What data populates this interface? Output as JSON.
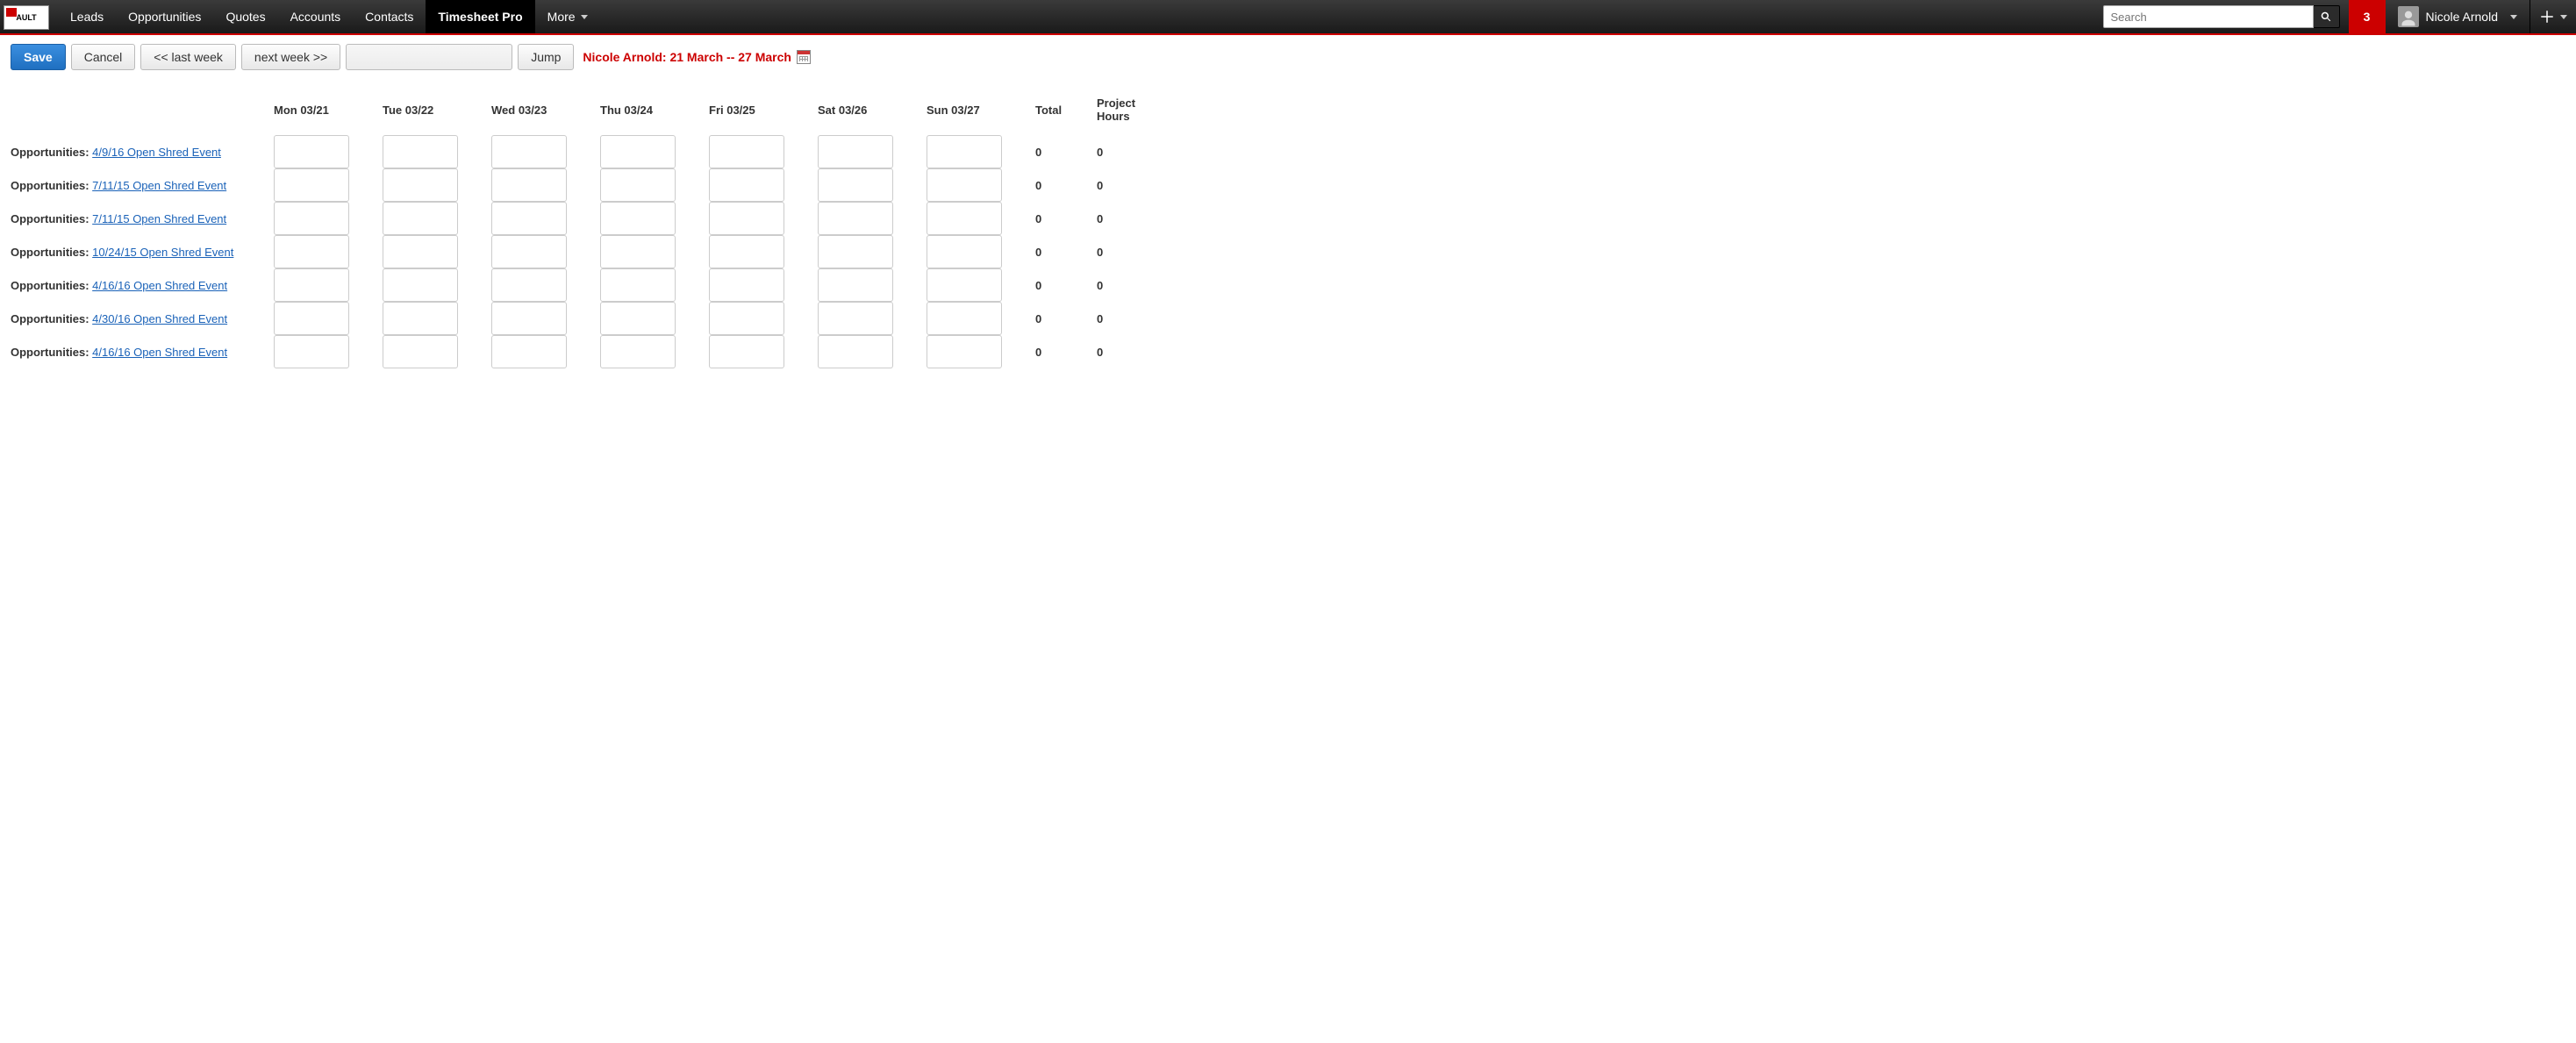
{
  "brand": {
    "logo_text": "AULT"
  },
  "nav": {
    "items": [
      "Leads",
      "Opportunities",
      "Quotes",
      "Accounts",
      "Contacts",
      "Timesheet Pro",
      "More"
    ],
    "active_index": 5
  },
  "search": {
    "placeholder": "Search"
  },
  "notifications": {
    "count": "3"
  },
  "user": {
    "name": "Nicole Arnold"
  },
  "toolbar": {
    "save": "Save",
    "cancel": "Cancel",
    "prev_week": "<< last week",
    "next_week": "next week >>",
    "jump": "Jump",
    "date_value": "",
    "range_label": "Nicole Arnold: 21 March -- 27 March"
  },
  "columns": {
    "days": [
      "Mon 03/21",
      "Tue 03/22",
      "Wed 03/23",
      "Thu 03/24",
      "Fri 03/25",
      "Sat 03/26",
      "Sun 03/27"
    ],
    "total": "Total",
    "project_hours": "Project Hours"
  },
  "rows": [
    {
      "prefix": "Opportunities:",
      "link": "4/9/16 Open Shred Event",
      "hours": [
        "",
        "",
        "",
        "",
        "",
        "",
        ""
      ],
      "total": "0",
      "project_hours": "0"
    },
    {
      "prefix": "Opportunities:",
      "link": "7/11/15 Open Shred Event",
      "hours": [
        "",
        "",
        "",
        "",
        "",
        "",
        ""
      ],
      "total": "0",
      "project_hours": "0"
    },
    {
      "prefix": "Opportunities:",
      "link": "7/11/15 Open Shred Event",
      "hours": [
        "",
        "",
        "",
        "",
        "",
        "",
        ""
      ],
      "total": "0",
      "project_hours": "0"
    },
    {
      "prefix": "Opportunities:",
      "link": "10/24/15 Open Shred Event",
      "hours": [
        "",
        "",
        "",
        "",
        "",
        "",
        ""
      ],
      "total": "0",
      "project_hours": "0"
    },
    {
      "prefix": "Opportunities:",
      "link": "4/16/16 Open Shred Event",
      "hours": [
        "",
        "",
        "",
        "",
        "",
        "",
        ""
      ],
      "total": "0",
      "project_hours": "0"
    },
    {
      "prefix": "Opportunities:",
      "link": "4/30/16 Open Shred Event",
      "hours": [
        "",
        "",
        "",
        "",
        "",
        "",
        ""
      ],
      "total": "0",
      "project_hours": "0"
    },
    {
      "prefix": "Opportunities:",
      "link": "4/16/16 Open Shred Event",
      "hours": [
        "",
        "",
        "",
        "",
        "",
        "",
        ""
      ],
      "total": "0",
      "project_hours": "0"
    }
  ]
}
